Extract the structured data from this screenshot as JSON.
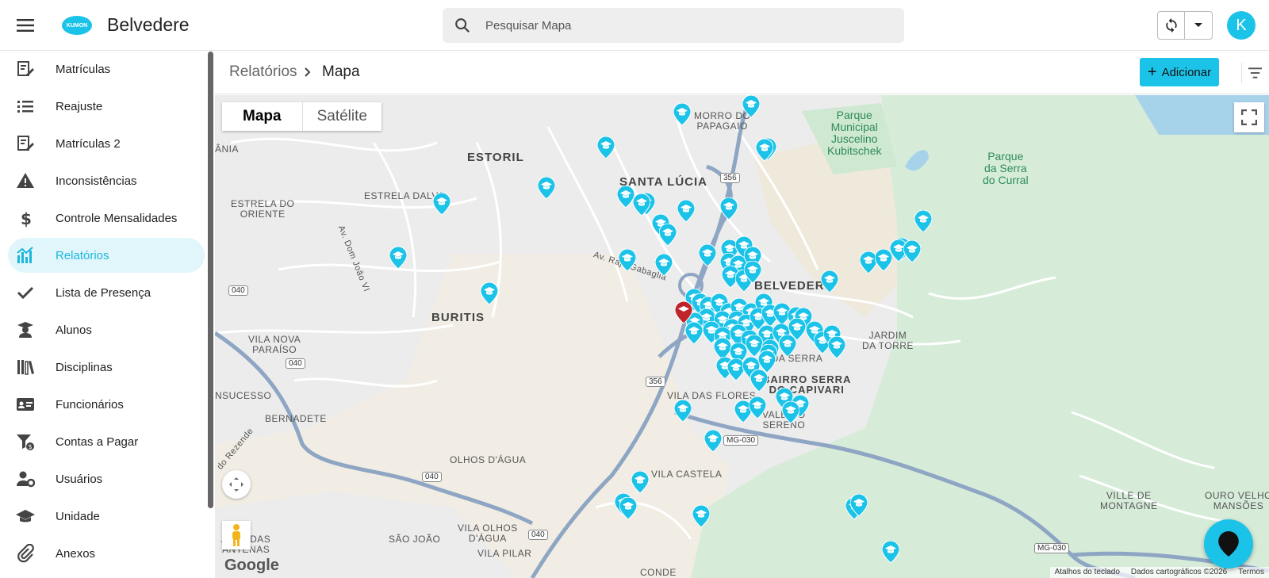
{
  "app": {
    "title": "Belvedere",
    "logo_text": "KUMON",
    "avatar_letter": "K"
  },
  "search": {
    "placeholder": "Pesquisar Mapa"
  },
  "sidebar": {
    "items": [
      {
        "label": "Matrículas",
        "icon": "edit-document-icon"
      },
      {
        "label": "Reajuste",
        "icon": "list-icon"
      },
      {
        "label": "Matrículas 2",
        "icon": "edit-document-icon"
      },
      {
        "label": "Inconsistências",
        "icon": "warning-icon"
      },
      {
        "label": "Controle Mensalidades",
        "icon": "dollar-icon"
      },
      {
        "label": "Relatórios",
        "icon": "chart-icon",
        "active": true
      },
      {
        "label": "Lista de Presença",
        "icon": "check-icon"
      },
      {
        "label": "Alunos",
        "icon": "student-icon"
      },
      {
        "label": "Disciplinas",
        "icon": "books-icon"
      },
      {
        "label": "Funcionários",
        "icon": "id-card-icon"
      },
      {
        "label": "Contas a Pagar",
        "icon": "filter-dollar-icon"
      },
      {
        "label": "Usuários",
        "icon": "user-gear-icon"
      },
      {
        "label": "Unidade",
        "icon": "graduation-cap-icon"
      },
      {
        "label": "Anexos",
        "icon": "paperclip-icon"
      }
    ]
  },
  "breadcrumb": {
    "parent": "Relatórios",
    "current": "Mapa"
  },
  "actions": {
    "add_label": "Adicionar"
  },
  "map": {
    "type_map": "Mapa",
    "type_satellite": "Satélite",
    "google": "Google",
    "attribution": [
      "Atalhos do teclado",
      "Dados cartográficos ©2026",
      "Termos"
    ],
    "labels": {
      "estoril": "ESTORIL",
      "santa_lucia": "SANTA LÚCIA",
      "morro": "MORRO DO\nPAPAGAIO",
      "estrela_dalva": "ESTRELA DALVA",
      "estrela_oriente": "ESTRELA DO\nORIENTE",
      "buritis": "BURITIS",
      "belvedere": "BELVEDERE",
      "vila_paraiso": "VILA NOVA\nPARAÍSO",
      "nsucesso": "NSUCESSO",
      "bernadete": "BERNADETE",
      "vila_flores": "VILA DAS FLORES",
      "serra": "BAIRRO SERRA\nDO CAPIVARI",
      "vale_sereno": "VALE DO\nSERENO",
      "jardim_torre": "JARDIM\nDA TORRE",
      "olhos_agua": "OLHOS D'ÁGUA",
      "vila_castela": "VILA CASTELA",
      "vila_olhos": "VILA OLHOS\nD'ÁGUA",
      "sao_joao": "SÃO JOÃO",
      "vila_pilar": "VILA PILAR",
      "alto_antenas": "ALTO DAS\nANTENAS",
      "conde": "CONDE",
      "montagne": "VILLE DE\nMONTAGNE",
      "ouro_velho": "OURO VELHO\nMANSÕES",
      "av_dom_joao": "Av. Dom João VI",
      "av_gabaglia": "Av. Raja Gabaglia",
      "park_jk": "Parque\nMunicipal\nJuscelino\nKubitschek",
      "park_serra": "Parque\nda Serra\ndo Curral",
      "ania": "ÂNIA",
      "lencia": "A DA SERRA",
      "rezende": "do Rezende"
    },
    "shields": [
      "356",
      "356",
      "040",
      "040",
      "040",
      "040",
      "MG-030",
      "MG-030"
    ]
  }
}
